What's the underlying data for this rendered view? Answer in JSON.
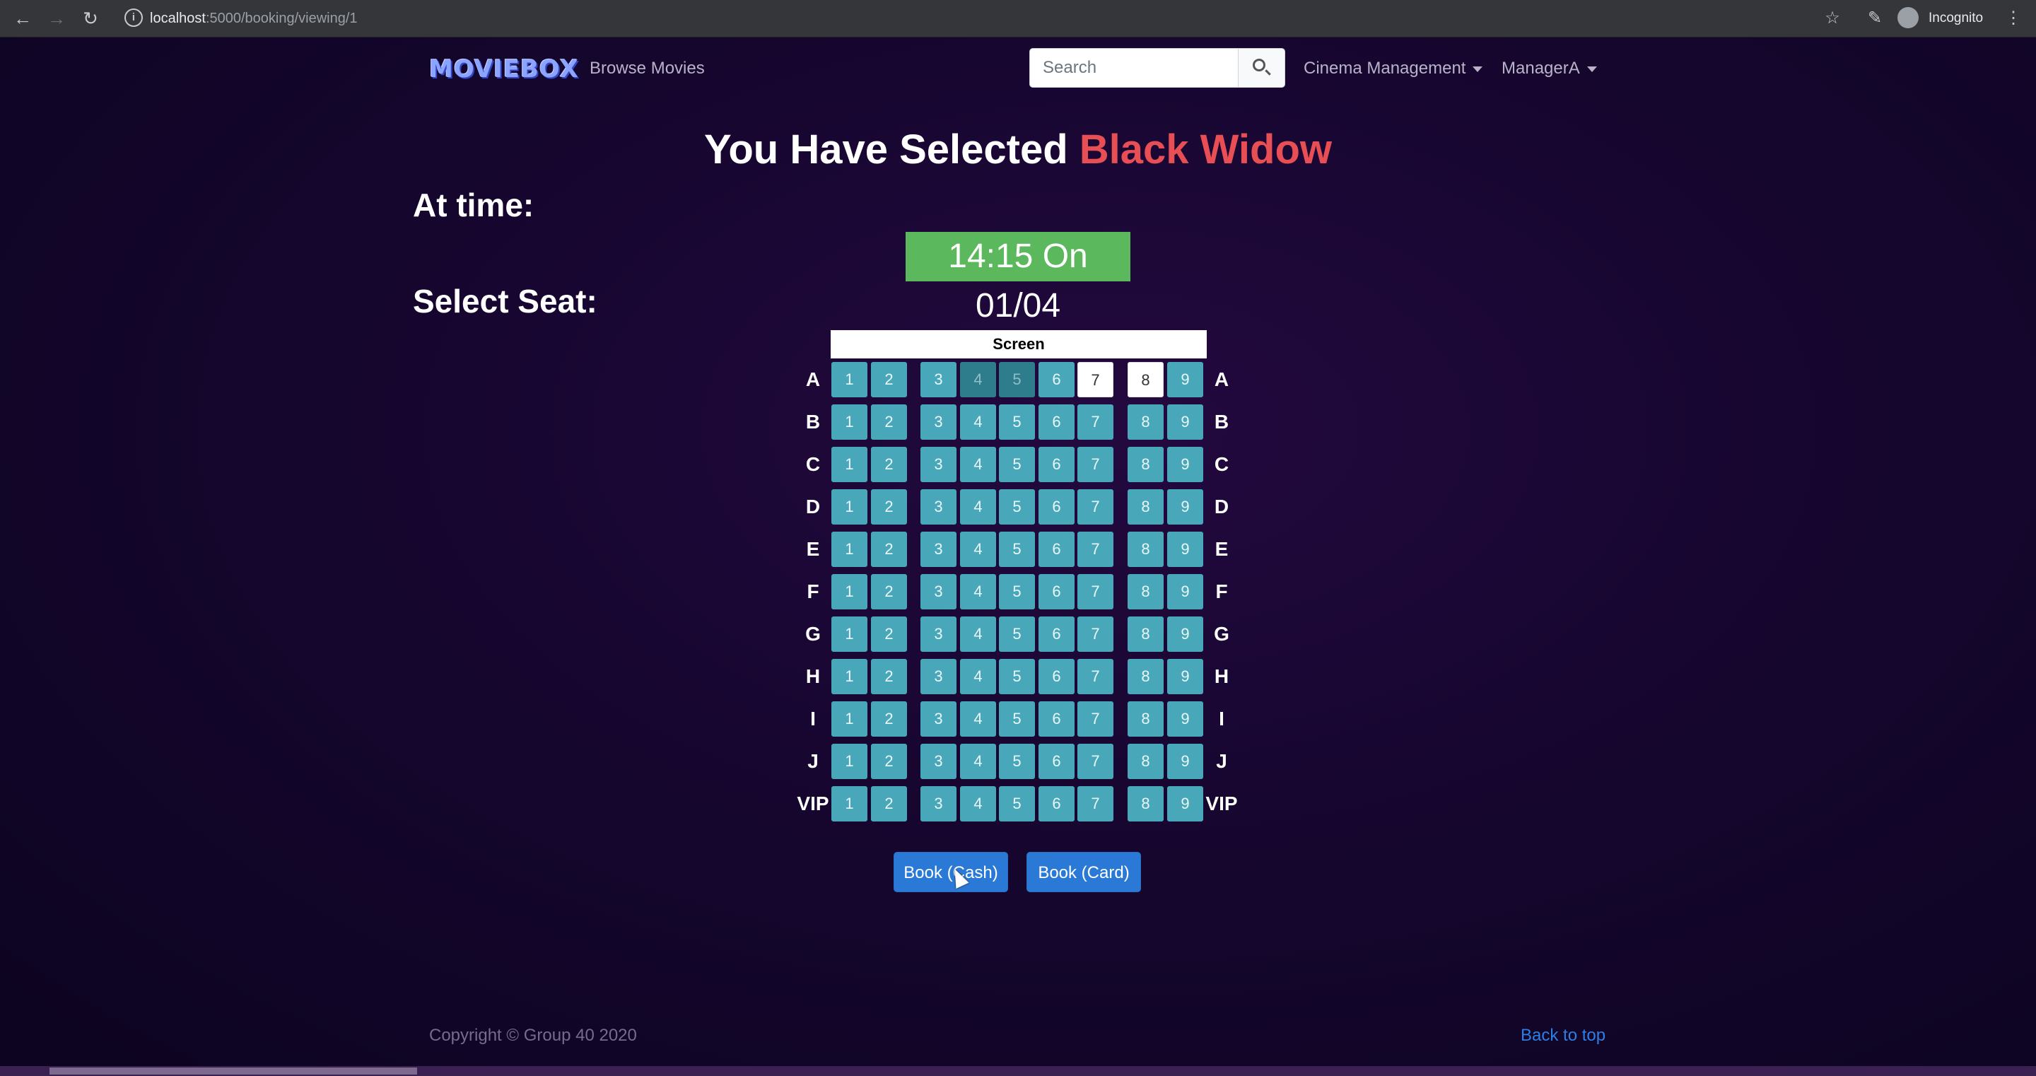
{
  "browser": {
    "url_host": "localhost",
    "url_path": ":5000/booking/viewing/1",
    "incognito_label": "Incognito"
  },
  "navbar": {
    "brand": "MOVIEBOX",
    "browse": "Browse Movies",
    "search_placeholder": "Search",
    "cinema_management": "Cinema Management",
    "user": "ManagerA"
  },
  "heading": {
    "prefix": "You Have Selected",
    "movie": "Black Widow"
  },
  "at_time_label": "At time:",
  "showtime": "14:15 On 01/04",
  "select_seat_label": "Select Seat:",
  "screen_label": "Screen",
  "rows": [
    "A",
    "B",
    "C",
    "D",
    "E",
    "F",
    "G",
    "H",
    "I",
    "J",
    "VIP"
  ],
  "seat_numbers": [
    "1",
    "2",
    "3",
    "4",
    "5",
    "6",
    "7",
    "8",
    "9"
  ],
  "booked_seats": [
    "A4",
    "A5"
  ],
  "selected_seats": [
    "A7",
    "A8"
  ],
  "colors": {
    "available_seat": "#48a7b8",
    "booked_seat": "#2e7d8c",
    "selected_seat": "#ffffff",
    "showtime_badge": "#5cb85c",
    "movie_title": "#e84f55",
    "button": "#2b79d6"
  },
  "buttons": {
    "book_cash": "Book (Cash)",
    "book_card": "Book (Card)"
  },
  "footer": {
    "copyright": "Copyright © Group 40 2020",
    "back_to_top": "Back to top"
  }
}
